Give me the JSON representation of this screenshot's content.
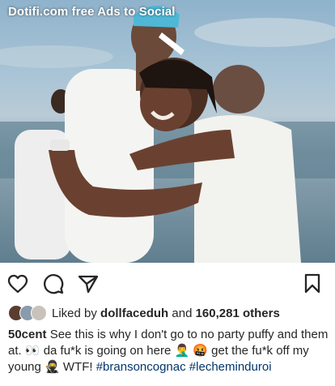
{
  "watermark": "Dotifi.com free Ads to Social",
  "icons": {
    "like": "heart-icon",
    "comment": "comment-icon",
    "share": "share-icon",
    "save": "bookmark-icon"
  },
  "likes": {
    "prefix": "Liked by",
    "user": "dollfaceduh",
    "joiner": "and",
    "count": "160,281 others"
  },
  "caption": {
    "username": "50cent",
    "text1": "See this is why I don't go to no party puffy and them at. 👀 da fu*k is going on here 🤦‍♂️ 🤬 get the fu*k off my young 🥷 WTF!",
    "hashtag1": "#bransoncognac",
    "hashtag2": "#lecheminduroi"
  },
  "colors": {
    "text": "#262626",
    "hashtag": "#00376b"
  }
}
